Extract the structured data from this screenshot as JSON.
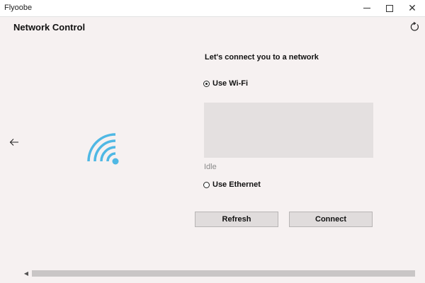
{
  "window": {
    "app_title": "Flyoobe",
    "minimize_icon": "minimize-icon",
    "maximize_icon": "maximize-icon",
    "close_icon": "close-icon",
    "close_glyph": "✕"
  },
  "header": {
    "title": "Network Control",
    "refresh_icon": "refresh-icon"
  },
  "nav": {
    "back_icon": "back-arrow-icon"
  },
  "illustration": {
    "icon": "wifi-icon",
    "color": "#4fb8e4"
  },
  "main": {
    "heading": "Let's connect you to a network",
    "options": [
      {
        "label": "Use Wi-Fi",
        "selected": true
      },
      {
        "label": "Use Ethernet",
        "selected": false
      }
    ],
    "status": "Idle",
    "buttons": {
      "refresh": "Refresh",
      "connect": "Connect"
    }
  },
  "scrollbar": {
    "left_glyph": "◀"
  }
}
